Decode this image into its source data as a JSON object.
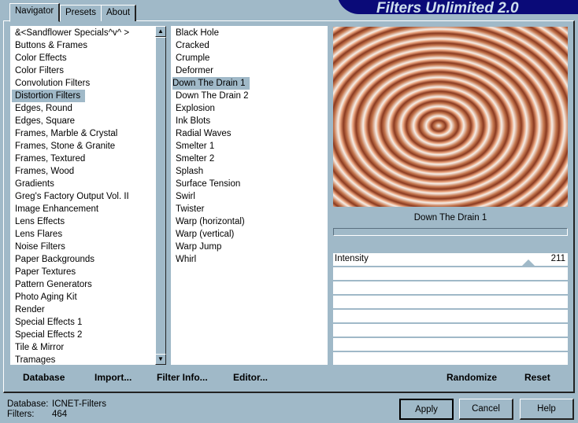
{
  "tabs": [
    "Navigator",
    "Presets",
    "About"
  ],
  "app_title": "Filters Unlimited 2.0",
  "categories": [
    "&<Sandflower Specials^v^ >",
    "Buttons & Frames",
    "Color Effects",
    "Color Filters",
    "Convolution Filters",
    "Distortion Filters",
    "Edges, Round",
    "Edges, Square",
    "Frames, Marble & Crystal",
    "Frames, Stone & Granite",
    "Frames, Textured",
    "Frames, Wood",
    "Gradients",
    "Greg's Factory Output Vol. II",
    "Image Enhancement",
    "Lens Effects",
    "Lens Flares",
    "Noise Filters",
    "Paper Backgrounds",
    "Paper Textures",
    "Pattern Generators",
    "Photo Aging Kit",
    "Render",
    "Special Effects 1",
    "Special Effects 2",
    "Tile & Mirror",
    "Tramages"
  ],
  "selected_category": "Distortion Filters",
  "filters": [
    "Black Hole",
    "Cracked",
    "Crumple",
    "Deformer",
    "Down The Drain 1",
    "Down The Drain 2",
    "Explosion",
    "Ink Blots",
    "Radial Waves",
    "Smelter 1",
    "Smelter 2",
    "Splash",
    "Surface Tension",
    "Swirl",
    "Twister",
    "Warp (horizontal)",
    "Warp (vertical)",
    "Warp Jump",
    "Whirl"
  ],
  "selected_filter": "Down The Drain 1",
  "preview_label": "Down The Drain 1",
  "slider": {
    "label": "Intensity",
    "value": "211",
    "max": 255
  },
  "buttons": {
    "database": "Database",
    "import": "Import...",
    "filter_info": "Filter Info...",
    "editor": "Editor...",
    "randomize": "Randomize",
    "reset": "Reset",
    "apply": "Apply",
    "cancel": "Cancel",
    "help": "Help"
  },
  "status": {
    "database_label": "Database:",
    "database_value": "ICNET-Filters",
    "filters_label": "Filters:",
    "filters_value": "464"
  }
}
